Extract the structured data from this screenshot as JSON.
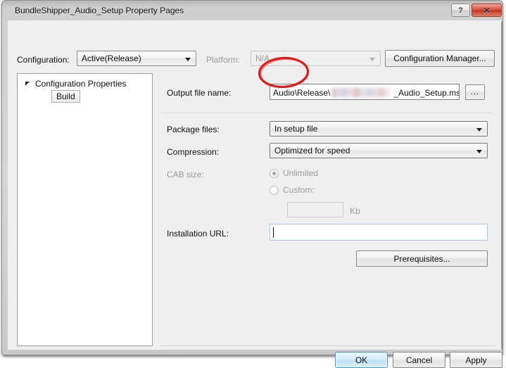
{
  "window": {
    "title": "BundleShipper_Audio_Setup Property Pages",
    "help_button": "?",
    "close_button": "✕"
  },
  "toolbar": {
    "configuration_label": "Configuration:",
    "configuration_value": "Active(Release)",
    "platform_label": "Platform:",
    "platform_value": "N/A",
    "configuration_manager_label": "Configuration Manager..."
  },
  "tree": {
    "root_label": "Configuration Properties",
    "expander_icon": "triangle-expanded-icon",
    "items": [
      {
        "label": "Build",
        "selected": true
      }
    ]
  },
  "build_page": {
    "output_file_name_label": "Output file name:",
    "output_file_name_prefix": "Audio\\Release\\",
    "output_file_name_redacted": "",
    "output_file_name_suffix": "_Audio_Setup.msi",
    "browse_button_label": "...",
    "package_files_label": "Package files:",
    "package_files_value": "In setup file",
    "package_files_options": [
      "In setup file"
    ],
    "compression_label": "Compression:",
    "compression_value": "Optimized for speed",
    "compression_options": [
      "Optimized for speed"
    ],
    "cab_size_label": "CAB size:",
    "cab_size_disabled": true,
    "cab_unlimited_label": "Unlimited",
    "cab_unlimited_selected": true,
    "cab_custom_label": "Custom:",
    "cab_custom_selected": false,
    "cab_custom_value": "",
    "cab_units_label": "Kb",
    "installation_url_label": "Installation URL:",
    "installation_url_value": "",
    "installation_url_focused": true,
    "prerequisites_button_label": "Prerequisites..."
  },
  "footer": {
    "ok_label": "OK",
    "cancel_label": "Cancel",
    "apply_label": "Apply"
  },
  "annotation": {
    "shape": "ellipse",
    "color": "#e01b18",
    "targets": "output_file_name_prefix"
  },
  "colors": {
    "dialog_background": "#efefef",
    "field_background": "#ffffff",
    "accent_default_button": "#3c97d3",
    "close_button": "#c23a24",
    "disabled_text": "#9a9a9a",
    "annotation_red": "#e01b18"
  }
}
